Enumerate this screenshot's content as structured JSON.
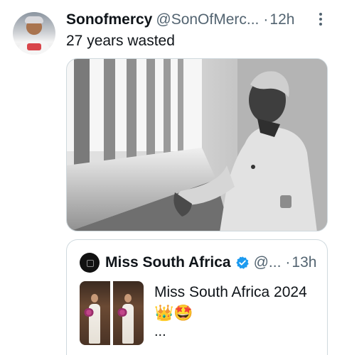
{
  "tweet": {
    "author_name": "Sonofmercy",
    "author_handle": "@SonOfMerc...",
    "separator": "·",
    "time": "12h",
    "text": "27 years wasted",
    "more_icon": "more-vertical-icon"
  },
  "quoted_tweet": {
    "author_name": "Miss South Africa",
    "verified_icon": "verified-badge-icon",
    "author_handle": "@...",
    "separator": "·",
    "time": "13h",
    "text": "Miss South Africa 2024",
    "emoji": "👑🤩",
    "ellipsis": "..."
  },
  "colors": {
    "text_primary": "#0f1419",
    "text_secondary": "#536471",
    "border": "#cfd9de",
    "verified": "#1d9bf0"
  }
}
